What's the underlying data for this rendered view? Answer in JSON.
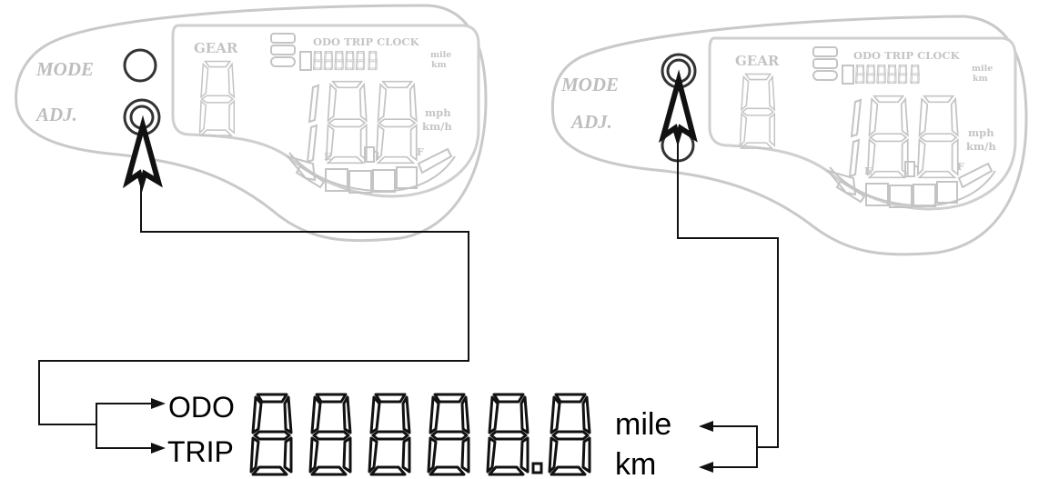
{
  "dashboards": [
    {
      "mode_label": "MODE",
      "adj_label": "ADJ.",
      "gear_label": "GEAR",
      "display_modes": "ODO TRIP CLOCK",
      "small_unit_top": "mile",
      "small_unit_bottom": "km",
      "speed_unit_top": "mph",
      "speed_unit_bottom": "km/h",
      "fuel_empty": "E",
      "fuel_full": "F",
      "pressed_button": "ADJ."
    },
    {
      "mode_label": "MODE",
      "adj_label": "ADJ.",
      "gear_label": "GEAR",
      "display_modes": "ODO TRIP CLOCK",
      "small_unit_top": "mile",
      "small_unit_bottom": "km",
      "speed_unit_top": "mph",
      "speed_unit_bottom": "km/h",
      "fuel_empty": "E",
      "fuel_full": "F",
      "pressed_button": "MODE"
    }
  ],
  "readout": {
    "mode_options": [
      "ODO",
      "TRIP"
    ],
    "unit_options": [
      "mile",
      "km"
    ],
    "digits": "88888.8"
  },
  "colors": {
    "ghost": "#c4c4c4",
    "ink": "#111111"
  },
  "icons": [
    "fuel-pump-icon",
    "arrow-up-icon"
  ]
}
